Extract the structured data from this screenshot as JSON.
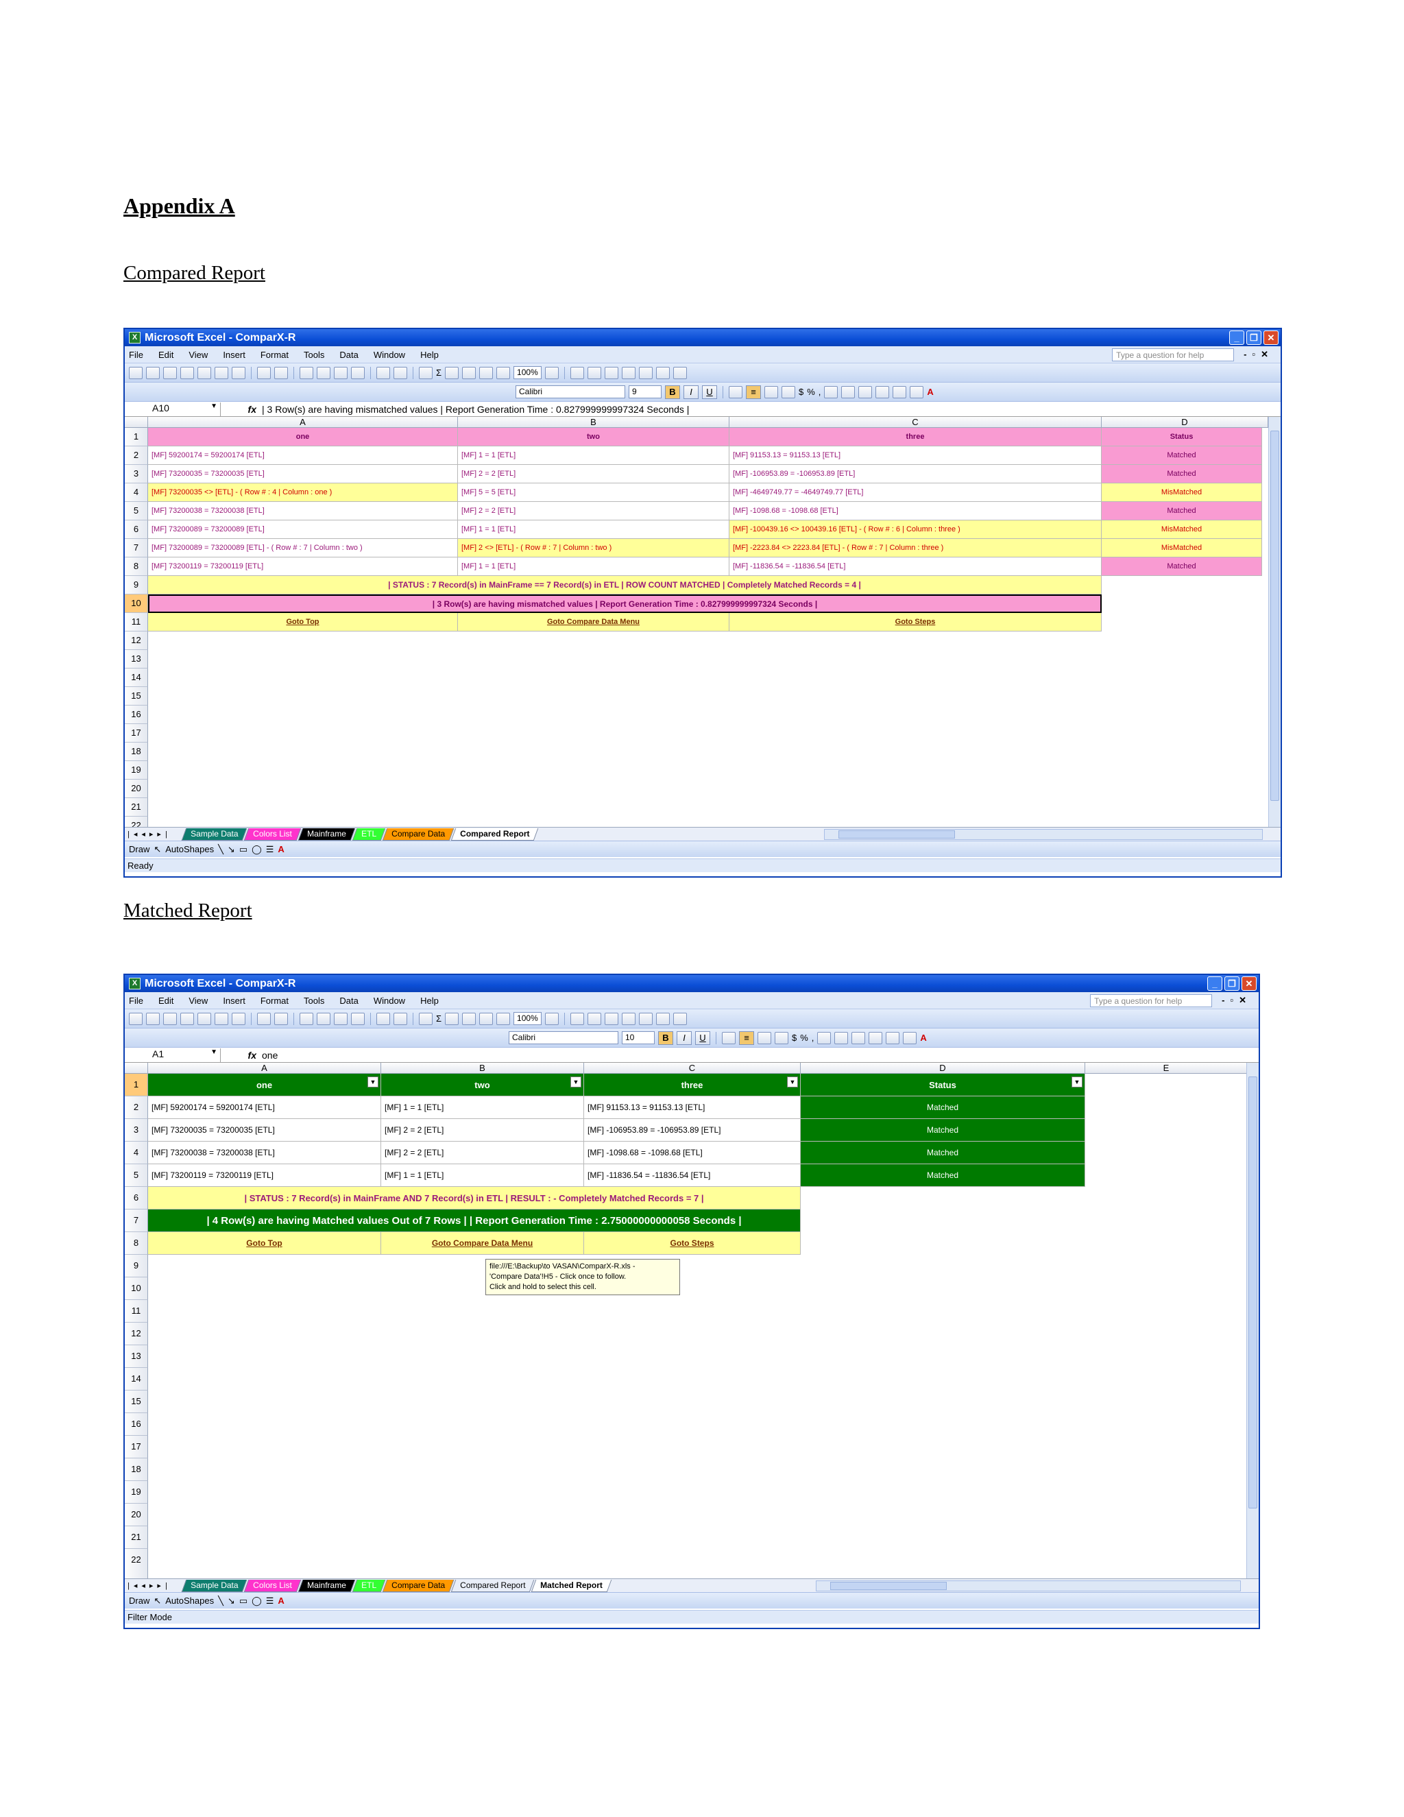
{
  "document": {
    "appendix_title": "Appendix A",
    "section1_title": "Compared Report",
    "section2_title": "Matched Report"
  },
  "common": {
    "window_title": "Microsoft Excel - ComparX-R",
    "menu": [
      "File",
      "Edit",
      "View",
      "Insert",
      "Format",
      "Tools",
      "Data",
      "Window",
      "Help"
    ],
    "help_placeholder": "Type a question for help",
    "zoom": "100%",
    "font_name": "Calibri",
    "draw_label": "Draw",
    "autoshapes_label": "AutoShapes",
    "icons": {
      "excel": "excel-logo-icon",
      "fx": "function-icon",
      "minimize": "minimize-icon",
      "restore": "restore-icon",
      "close": "close-icon",
      "filter": "chevron-down-icon"
    },
    "colors": {
      "title_blue": "#0b4ed6",
      "pink": "#f99bd2",
      "yellow": "#ffff99",
      "green": "#007a00"
    }
  },
  "win1": {
    "font_size": "9",
    "name_box": "A10",
    "formula": "| 3 Row(s) are having mismatched values   | Report Generation Time : 0.827999999997324 Seconds |",
    "columns": [
      "A",
      "B",
      "C",
      "D"
    ],
    "row_numbers": [
      "1",
      "2",
      "3",
      "4",
      "5",
      "6",
      "7",
      "8",
      "9",
      "10",
      "11",
      "12",
      "13",
      "14",
      "15",
      "16",
      "17",
      "18",
      "19",
      "20",
      "21",
      "22"
    ],
    "headers": [
      "one",
      "two",
      "three",
      "Status"
    ],
    "rows": [
      {
        "a": "[MF]   59200174  =  59200174   [ETL]",
        "b": "[MF]   1  =  1   [ETL]",
        "c": "[MF]   91153.13  =  91153.13   [ETL]",
        "status": "Matched"
      },
      {
        "a": "[MF]   73200035  =  73200035   [ETL]",
        "b": "[MF]   2  =  2   [ETL]",
        "c": "[MF]   -106953.89  =  -106953.89   [ETL]",
        "status": "Matched"
      },
      {
        "a": "[MF]     73200035   <>         [ETL]   -   ( Row # : 4  |  Column : one )",
        "b": "[MF]   5  =  5   [ETL]",
        "c": "[MF]   -4649749.77  =  -4649749.77   [ETL]",
        "status": "MisMatched"
      },
      {
        "a": "[MF]   73200038  =  73200038   [ETL]",
        "b": "[MF]   2  =  2   [ETL]",
        "c": "[MF]   -1098.68  =  -1098.68   [ETL]",
        "status": "Matched"
      },
      {
        "a": "[MF]   73200089  =  73200089   [ETL]",
        "b": "[MF]   1  =  1   [ETL]",
        "c": "[MF]      -100439.16    <>    100439.16       [ETL]   -   ( Row # : 6  |  Column : three )",
        "status": "MisMatched"
      },
      {
        "a": "[MF]   73200089  =  73200089   [ETL]   -   ( Row # : 7  |  Column : two )",
        "b": "[MF]      2    <>         [ETL]   -   ( Row # : 7  |  Column : two )",
        "c": "[MF]      -2223.84    <>    2223.84       [ETL]   -   ( Row # : 7  |  Column : three )",
        "status": "MisMatched"
      },
      {
        "a": "[MF]   73200119  =  73200119   [ETL]",
        "b": "[MF]   1  =  1   [ETL]",
        "c": "[MF]   -11836.54  =  -11836.54   [ETL]",
        "status": "Matched"
      }
    ],
    "status_row": "| STATUS  :  7 Record(s) in MainFrame  ==  7 Record(s) in ETL   |  ROW COUNT MATCHED   |  Completely Matched Records = 4 |",
    "mismatch_row": "| 3 Row(s) are having mismatched values   | Report Generation Time : 0.827999999997324 Seconds |",
    "links": [
      "Goto Top",
      "Goto Compare Data Menu",
      "Goto Steps"
    ],
    "sheet_tabs": [
      "Sample Data",
      "Colors List",
      "Mainframe",
      "ETL",
      "Compare Data",
      "Compared Report"
    ],
    "status_text": "Ready"
  },
  "win2": {
    "font_size": "10",
    "name_box": "A1",
    "formula": "one",
    "columns": [
      "A",
      "B",
      "C",
      "D",
      "E"
    ],
    "row_numbers": [
      "1",
      "2",
      "3",
      "4",
      "5",
      "6",
      "7",
      "8",
      "9",
      "10",
      "11",
      "12",
      "13",
      "14",
      "15",
      "16",
      "17",
      "18",
      "19",
      "20",
      "21",
      "22"
    ],
    "headers": [
      "one",
      "two",
      "three",
      "Status"
    ],
    "rows": [
      {
        "a": "[MF]   59200174  =  59200174   [ETL]",
        "b": "[MF]   1  =  1   [ETL]",
        "c": "[MF]   91153.13  =  91153.13   [ETL]",
        "status": "Matched"
      },
      {
        "a": "[MF]   73200035  =  73200035   [ETL]",
        "b": "[MF]   2  =  2   [ETL]",
        "c": "[MF]   -106953.89  =  -106953.89   [ETL]",
        "status": "Matched"
      },
      {
        "a": "[MF]   73200038  =  73200038   [ETL]",
        "b": "[MF]   2  =  2   [ETL]",
        "c": "[MF]   -1098.68  =  -1098.68   [ETL]",
        "status": "Matched"
      },
      {
        "a": "[MF]   73200119  =  73200119   [ETL]",
        "b": "[MF]   1  =  1   [ETL]",
        "c": "[MF]   -11836.54  =  -11836.54   [ETL]",
        "status": "Matched"
      }
    ],
    "status_row": "| STATUS : 7 Record(s) in MainFrame     AND     7 Record(s) in ETL    |    RESULT : - Completely Matched Records = 7 |",
    "matched_row": "| 4  Row(s) are having Matched values    Out of  7 Rows | | Report Generation Time : 2.75000000000058 Seconds |",
    "links": [
      "Goto Top",
      "Goto Compare Data Menu",
      "Goto Steps"
    ],
    "tooltip": "file:///E:\\Backup\\to VASAN\\ComparX-R.xls -\n'Compare Data'!H5 - Click once to follow.\nClick and hold to select this cell.",
    "sheet_tabs": [
      "Sample Data",
      "Colors List",
      "Mainframe",
      "ETL",
      "Compare Data",
      "Compared Report",
      "Matched Report"
    ],
    "status_text": "Filter Mode"
  }
}
